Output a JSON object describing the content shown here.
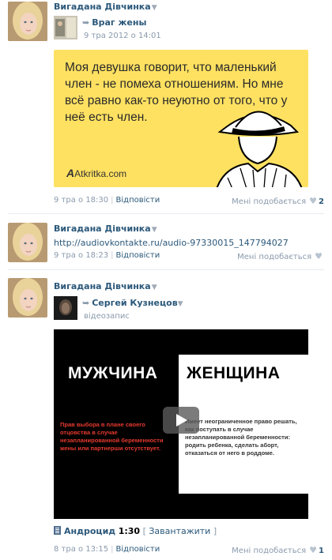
{
  "posts": [
    {
      "author": "Вигадана Дівчинка",
      "repost": {
        "name": "Враг жены",
        "date": "9 тра 2012 о 14:01"
      },
      "image": {
        "text": "Моя девушка говорит, что маленький член - не помеха отношениям. Но мне всё равно как-то неуютно от того, что у неё есть член.",
        "logo": "Atkritka.com"
      },
      "footer": {
        "time": "9 тра о 18:30",
        "reply": "Відповісти",
        "like": "Мені подобається",
        "count": "2"
      }
    },
    {
      "author": "Вигадана Дівчинка",
      "link": "http://audiovkontakte.ru/audio-97330015_147794027",
      "footer": {
        "time": "9 тра о 18:23",
        "reply": "Відповісти",
        "like": "Мені подобається",
        "count": ""
      }
    },
    {
      "author": "Вигадана Дівчинка",
      "repost": {
        "name": "Сергей Кузнецов",
        "type": "відеозапис"
      },
      "video": {
        "title_left": "МУЖЧИНА",
        "title_right": "ЖЕНЩИНА",
        "text_left": "Прав выбора в плане своего отцовства в случае незапланированной беременности жены или партнерши отсутствует.",
        "text_right": "Имеет неограниченное право решать, как поступать в случае незапланированной беременности: родить ребенка, сделать аборт, отказаться от него в роддоме."
      },
      "audio": {
        "name": "Андроцид",
        "duration": "1:30",
        "download": "Завантажити"
      },
      "footer": {
        "time": "8 тра о 13:15",
        "reply": "Відповісти",
        "like": "Мені подобається",
        "count": "1"
      }
    }
  ],
  "colors": {
    "link": "#2b587a",
    "muted": "#8a9aac",
    "meme_bg": "#ffe161"
  }
}
